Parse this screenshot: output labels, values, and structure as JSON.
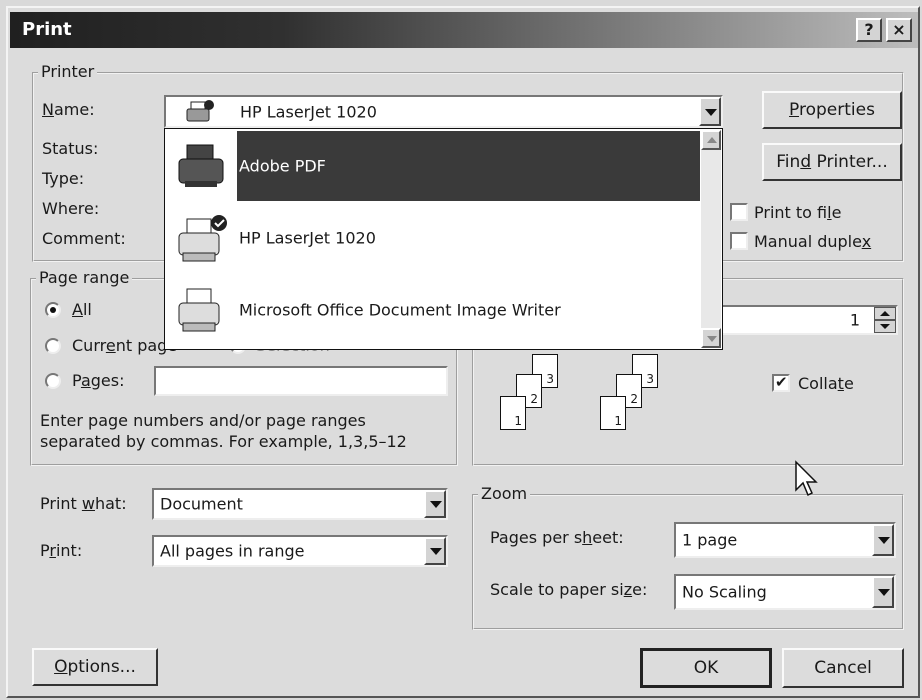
{
  "window": {
    "title": "Print",
    "help_label": "?",
    "close_label": "×"
  },
  "printer": {
    "legend": "Printer",
    "name_label": "Name:",
    "name_value": "HP LaserJet 1020",
    "status_label": "Status:",
    "type_label": "Type:",
    "where_label": "Where:",
    "comment_label": "Comment:",
    "properties_label": "Properties",
    "find_printer_label": "Find Printer...",
    "print_to_file_label": "Print to file",
    "manual_duplex_label": "Manual duplex",
    "print_to_file_checked": false,
    "manual_duplex_checked": false
  },
  "printer_list": {
    "items": [
      {
        "label": "Adobe PDF",
        "icon": "printer-icon",
        "selected": true
      },
      {
        "label": "HP LaserJet 1020",
        "icon": "default-printer-icon",
        "selected": false
      },
      {
        "label": "Microsoft Office Document Image Writer",
        "icon": "printer-icon",
        "selected": false
      }
    ]
  },
  "page_range": {
    "legend": "Page range",
    "all_label": "All",
    "current_page_label": "Current page",
    "selection_label": "Selection",
    "pages_label": "Pages:",
    "pages_value": "",
    "selected": "All",
    "hint": "Enter page numbers and/or page ranges separated by commas.  For example, 1,3,5–12"
  },
  "copies": {
    "count_value": "1",
    "collate_label": "Collate",
    "collate_checked": true,
    "stack1_pages": [
      "1",
      "2",
      "3"
    ],
    "stack2_pages": [
      "1",
      "2",
      "3"
    ]
  },
  "print_what": {
    "label": "Print what:",
    "value": "Document"
  },
  "print_range": {
    "label": "Print:",
    "value": "All pages in range"
  },
  "zoom": {
    "legend": "Zoom",
    "pages_per_sheet_label": "Pages per sheet:",
    "pages_per_sheet_value": "1 page",
    "scale_label": "Scale to paper size:",
    "scale_value": "No Scaling"
  },
  "buttons": {
    "options": "Options...",
    "ok": "OK",
    "cancel": "Cancel"
  },
  "colors": {
    "selection": "#3a3a3a",
    "dialog_bg": "#dcdcdc"
  }
}
